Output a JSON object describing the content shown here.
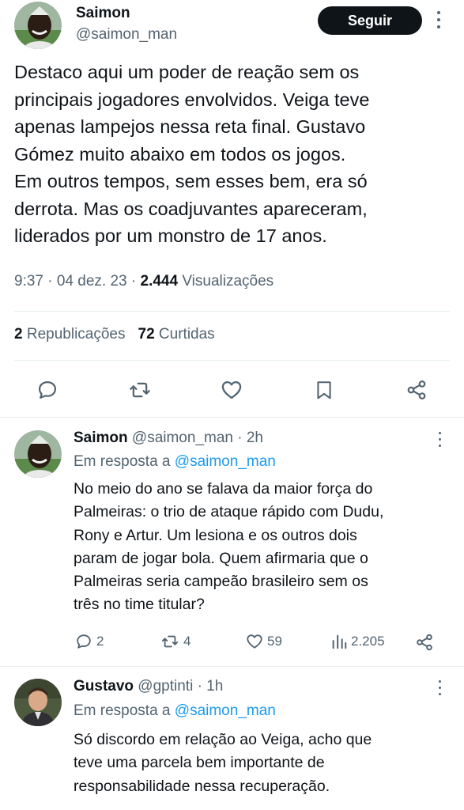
{
  "main_tweet": {
    "author_name": "Saimon",
    "author_handle": "@saimon_man",
    "follow_label": "Seguir",
    "text_lines": [
      "Destaco aqui um poder de reação sem os",
      "principais jogadores envolvidos. Veiga teve",
      "apenas lampejos nessa reta final. Gustavo",
      "Gómez muito abaixo em todos os jogos.",
      "Em outros tempos, sem esses bem, era só",
      "derrota. Mas os coadjuvantes apareceram,",
      "liderados por um monstro de 17 anos."
    ],
    "time": "9:37 · 04 dez. 23 · ",
    "views_count": "2.444",
    "views_label": " Visualizações",
    "reposts_count": "2",
    "reposts_label": " Republicações",
    "likes_count": "72",
    "likes_label": " Curtidas",
    "actions": [
      "reply-icon",
      "repost-icon",
      "like-icon",
      "bookmark-icon",
      "share-icon"
    ]
  },
  "replies": [
    {
      "author_name": "Saimon",
      "meta": " @saimon_man · 2h",
      "in_reply_prefix": "Em resposta a ",
      "in_reply_mention": "@saimon_man",
      "text_lines": [
        "No meio do ano se falava da maior força do",
        "Palmeiras: o trio de ataque rápido com Dudu,",
        "Rony e Artur. Um lesiona e os outros dois",
        "param de jogar bola. Quem afirmaria que o",
        "Palmeiras seria campeão brasileiro sem os",
        "três no time titular?"
      ],
      "reply_count": "2",
      "repost_count": "4",
      "like_count": "59",
      "view_count": "2.205"
    },
    {
      "author_name": "Gustavo",
      "meta": " @gptinti · 1h",
      "in_reply_prefix": "Em resposta a ",
      "in_reply_mention": "@saimon_man",
      "text_lines": [
        "Só discordo em relação ao Veiga, acho que",
        "teve uma parcela bem importante de",
        "responsabilidade nessa recuperação."
      ]
    }
  ],
  "colors": {
    "text": "#0f1419",
    "secondary": "#536471",
    "link": "#1d9bf0",
    "divider": "#e6ecf0",
    "button": "#0f1419"
  }
}
